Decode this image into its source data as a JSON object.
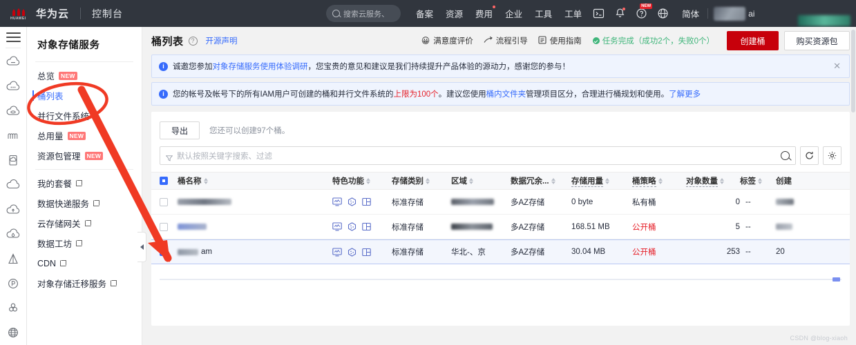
{
  "topbar": {
    "brand": "华为云",
    "console": "控制台",
    "search_placeholder": "搜索云服务、",
    "nav": [
      {
        "label": "备案",
        "dot": false
      },
      {
        "label": "资源",
        "dot": false
      },
      {
        "label": "费用",
        "dot": true
      },
      {
        "label": "企业",
        "dot": false
      },
      {
        "label": "工具",
        "dot": false
      },
      {
        "label": "工单",
        "dot": false
      }
    ],
    "icons": [
      {
        "name": "cloudshell-icon",
        "dot": false,
        "badge": ""
      },
      {
        "name": "bell-icon",
        "dot": true,
        "badge": ""
      },
      {
        "name": "help-icon",
        "dot": false,
        "badge": "NEW"
      },
      {
        "name": "globe-icon",
        "dot": false,
        "badge": ""
      }
    ],
    "lang": "简体",
    "ai_label": "ai"
  },
  "rail": {
    "menu_icon": "hamburger-icon",
    "icons": [
      "cloud-obs-icon",
      "cloud-dots-icon",
      "cloud-disk-icon",
      "waves-icon",
      "doc-cloud-icon",
      "cloud-plain-icon",
      "cloud-upload-icon",
      "cloud-drop-icon",
      "pyramid-icon",
      "p-circle-icon",
      "cluster-icon",
      "globe-w-icon"
    ]
  },
  "sidebar": {
    "title": "对象存储服务",
    "groups": [
      {
        "items": [
          {
            "label": "总览",
            "badge": "NEW",
            "external": false,
            "active": false
          },
          {
            "label": "桶列表",
            "badge": "",
            "external": false,
            "active": true
          },
          {
            "label": "并行文件系统",
            "badge": "",
            "external": false,
            "active": false
          },
          {
            "label": "总用量",
            "badge": "NEW",
            "external": false,
            "active": false
          },
          {
            "label": "资源包管理",
            "badge": "NEW",
            "external": false,
            "active": false
          }
        ]
      },
      {
        "items": [
          {
            "label": "我的套餐",
            "badge": "",
            "external": true,
            "active": false
          },
          {
            "label": "数据快递服务",
            "badge": "",
            "external": true,
            "active": false
          },
          {
            "label": "云存储网关",
            "badge": "",
            "external": true,
            "active": false
          },
          {
            "label": "数据工坊",
            "badge": "",
            "external": true,
            "active": false
          },
          {
            "label": "CDN",
            "badge": "",
            "external": true,
            "active": false
          },
          {
            "label": "对象存储迁移服务",
            "badge": "",
            "external": true,
            "active": false
          }
        ]
      }
    ]
  },
  "header": {
    "title": "桶列表",
    "help_icon": "question-mark-icon",
    "oss_link": "开源声明",
    "actions": [
      {
        "label": "满意度评价",
        "icon": "smiley-icon"
      },
      {
        "label": "流程引导",
        "icon": "guide-icon"
      },
      {
        "label": "使用指南",
        "icon": "manual-icon"
      }
    ],
    "task_status": "任务完成（成功2个，失败0个）",
    "task_status_color": "#3fb57a",
    "create_button": "创建桶",
    "buy_button": "购买资源包",
    "create_button_color": "#c7000b"
  },
  "alerts": [
    {
      "prefix": "诚邀您参加",
      "link": "对象存储服务使用体验调研",
      "suffix": "，您宝贵的意见和建议是我们持续提升产品体验的源动力，感谢您的参与！",
      "closable": true
    },
    {
      "prefix": "您的帐号及帐号下的所有IAM用户可创建的桶和并行文件系统的",
      "highlight": "上限为100个",
      "mid": "。建议您使用",
      "link": "桶内文件夹",
      "suffix": "管理项目区分，合理进行桶规划和使用。",
      "more": "了解更多",
      "closable": false
    }
  ],
  "toolbar": {
    "export_label": "导出",
    "quota_hint": "您还可以创建97个桶。",
    "search_placeholder": "默认按照关键字搜索、过滤",
    "search_value": "",
    "refresh_icon": "refresh-icon",
    "settings_icon": "gear-icon",
    "filter_icon": "funnel-icon",
    "search_icon": "search-icon"
  },
  "table": {
    "columns": [
      {
        "key": "name",
        "label": "桶名称",
        "sortable": true,
        "dashed": false
      },
      {
        "key": "features",
        "label": "特色功能",
        "sortable": true,
        "dashed": false
      },
      {
        "key": "storage_class",
        "label": "存储类别",
        "sortable": true,
        "dashed": false
      },
      {
        "key": "region",
        "label": "区域",
        "sortable": true,
        "dashed": false
      },
      {
        "key": "redundancy",
        "label": "数据冗余...",
        "sortable": true,
        "dashed": false
      },
      {
        "key": "usage",
        "label": "存储用量",
        "sortable": true,
        "dashed": true
      },
      {
        "key": "policy",
        "label": "桶策略",
        "sortable": true,
        "dashed": true
      },
      {
        "key": "object_count",
        "label": "对象数量",
        "sortable": true,
        "dashed": true
      },
      {
        "key": "tag",
        "label": "标签",
        "sortable": true,
        "dashed": false
      },
      {
        "key": "created",
        "label": "创建",
        "sortable": false,
        "dashed": false
      }
    ],
    "feature_icons": [
      "monitor-icon",
      "hexagon-icon",
      "layout-icon"
    ],
    "rows": [
      {
        "selected": false,
        "name": "",
        "name_redacted": true,
        "storage_class": "标准存储",
        "region": "",
        "region_redacted": true,
        "redundancy": "多AZ存储",
        "usage": "0 byte",
        "policy": "私有桶",
        "policy_public": false,
        "object_count": "0",
        "tag": "--",
        "created": "2",
        "created_redacted": true
      },
      {
        "selected": false,
        "name": "",
        "name_redacted": true,
        "storage_class": "标准存储",
        "region": "",
        "region_redacted": true,
        "redundancy": "多AZ存储",
        "usage": "168.51 MB",
        "policy": "公开桶",
        "policy_public": true,
        "object_count": "5",
        "tag": "--",
        "created": "20",
        "created_redacted": true
      },
      {
        "selected": true,
        "name": "am",
        "name_redacted": true,
        "storage_class": "标准存储",
        "region": "华北-、京",
        "region_redacted": true,
        "redundancy": "多AZ存储",
        "usage": "30.04 MB",
        "policy": "公开桶",
        "policy_public": true,
        "object_count": "253",
        "tag": "--",
        "created": "20",
        "created_redacted": false
      }
    ]
  },
  "watermark": "CSDN @blog-xiaoh"
}
